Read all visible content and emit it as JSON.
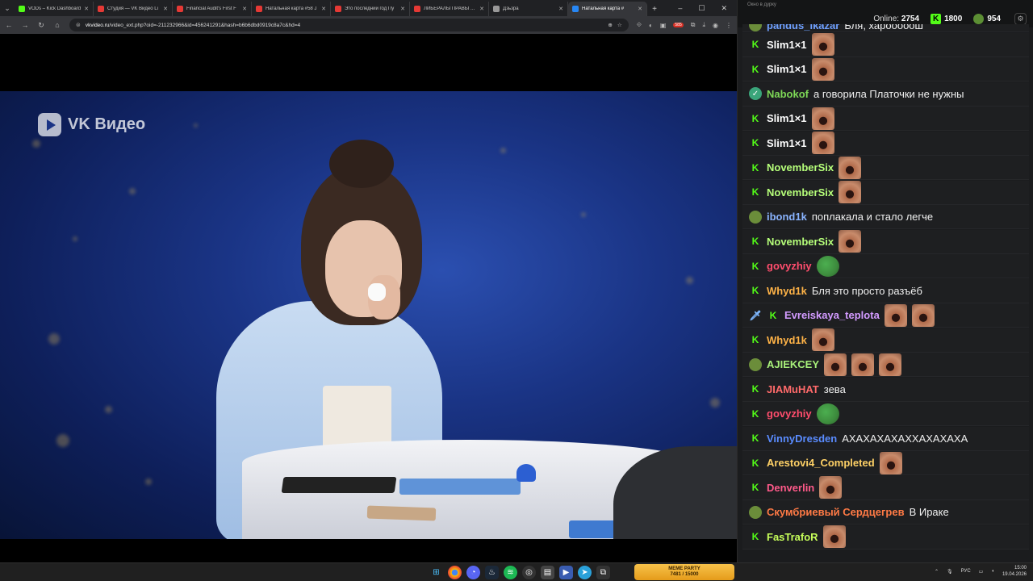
{
  "browser": {
    "tabs": [
      {
        "title": "VODs – Kick Dashboard",
        "color": "#53fc18"
      },
      {
        "title": "Студия — VK Видео Li",
        "color": "#e53935"
      },
      {
        "title": "Financial Audit's First F",
        "color": "#e53935"
      },
      {
        "title": "Натальная карта #58 J",
        "color": "#e53935"
      },
      {
        "title": "Это последний год Пу",
        "color": "#e53935"
      },
      {
        "title": "ЛИБЕРАЛЫ ПРАВЫ ВС",
        "color": "#e53935"
      },
      {
        "title": "Дзьзра",
        "color": "#999999"
      },
      {
        "title": "Натальная карта #",
        "color": "#2787f5"
      }
    ],
    "url_host": "vkvideo.ru",
    "url_path": "/video_ext.php?oid=-211232966&id=456241291&hash=b6b6dbd0919c8a7c&hd=4",
    "extension_badge": "585"
  },
  "video": {
    "watermark": "VK Видео"
  },
  "chat": {
    "window_title": "Окно в дурку",
    "online_label": "Online:",
    "online_count": "2754",
    "kick_points": "1800",
    "pepe_points": "954",
    "messages": [
      {
        "user": "pandus_ikazar",
        "color": "#6fa0ff",
        "badge": "pepe",
        "text": "Бля, харооооош",
        "emotes": 0
      },
      {
        "user": "Slim1×1",
        "color": "#ffffff",
        "badge": "kick",
        "text": "",
        "emotes": 1
      },
      {
        "user": "Slim1×1",
        "color": "#ffffff",
        "badge": "kick",
        "text": "",
        "emotes": 1
      },
      {
        "user": "Nabokof",
        "color": "#7ed957",
        "badge": "verified",
        "text": "а говорила Платочки не нужны",
        "emotes": 0
      },
      {
        "user": "Slim1×1",
        "color": "#ffffff",
        "badge": "kick",
        "text": "",
        "emotes": 1
      },
      {
        "user": "Slim1×1",
        "color": "#ffffff",
        "badge": "kick",
        "text": "",
        "emotes": 1
      },
      {
        "user": "NovemberSix",
        "color": "#b6ff7a",
        "badge": "kick",
        "text": "",
        "emotes": 1
      },
      {
        "user": "NovemberSix",
        "color": "#b6ff7a",
        "badge": "kick",
        "text": "",
        "emotes": 1
      },
      {
        "user": "ibond1k",
        "color": "#8ab4ff",
        "badge": "pepe",
        "text": "поплакала и стало легче",
        "emotes": 0
      },
      {
        "user": "NovemberSix",
        "color": "#b6ff7a",
        "badge": "kick",
        "text": "",
        "emotes": 1
      },
      {
        "user": "govyzhiy",
        "color": "#ff4d6d",
        "badge": "kick",
        "text": "",
        "emotes": 1,
        "frog": true
      },
      {
        "user": "Whyd1k",
        "color": "#ffb347",
        "badge": "kick",
        "text": "Бля это просто разъёб",
        "emotes": 0
      },
      {
        "user": "Evreiskaya_teplota",
        "color": "#d39bff",
        "badge": "kick",
        "text": "",
        "emotes": 2,
        "sword": true
      },
      {
        "user": "Whyd1k",
        "color": "#ffb347",
        "badge": "kick",
        "text": "",
        "emotes": 1
      },
      {
        "user": "AJIEKCEY",
        "color": "#a8f07a",
        "badge": "pepe",
        "text": "",
        "emotes": 3
      },
      {
        "user": "JIAMuHAT",
        "color": "#ff6a6a",
        "badge": "kick",
        "text": "зева",
        "emotes": 0
      },
      {
        "user": "govyzhiy",
        "color": "#ff4d6d",
        "badge": "kick",
        "text": "",
        "emotes": 1,
        "frog": true
      },
      {
        "user": "VinnyDresden",
        "color": "#5a8cff",
        "badge": "kick",
        "text": "АХАХАХАХАХХАХАХАХА",
        "emotes": 0
      },
      {
        "user": "Arestovi4_Completed",
        "color": "#ffd166",
        "badge": "kick",
        "text": "",
        "emotes": 1
      },
      {
        "user": "Denverlin",
        "color": "#ff5a8a",
        "badge": "kick",
        "text": "",
        "emotes": 1
      },
      {
        "user": "Скумбриевый Сердцегрев",
        "color": "#ff7a45",
        "badge": "pepe",
        "text": "В Ираке",
        "emotes": 0
      },
      {
        "user": "FasTrafoR",
        "color": "#c7ff5a",
        "badge": "kick",
        "text": "",
        "emotes": 1
      }
    ]
  },
  "taskbar": {
    "meme_title": "MEME PARTY",
    "meme_progress": "7481 / 15000",
    "lang": "РУС",
    "time": "15:00",
    "date": "19.04.2026"
  }
}
